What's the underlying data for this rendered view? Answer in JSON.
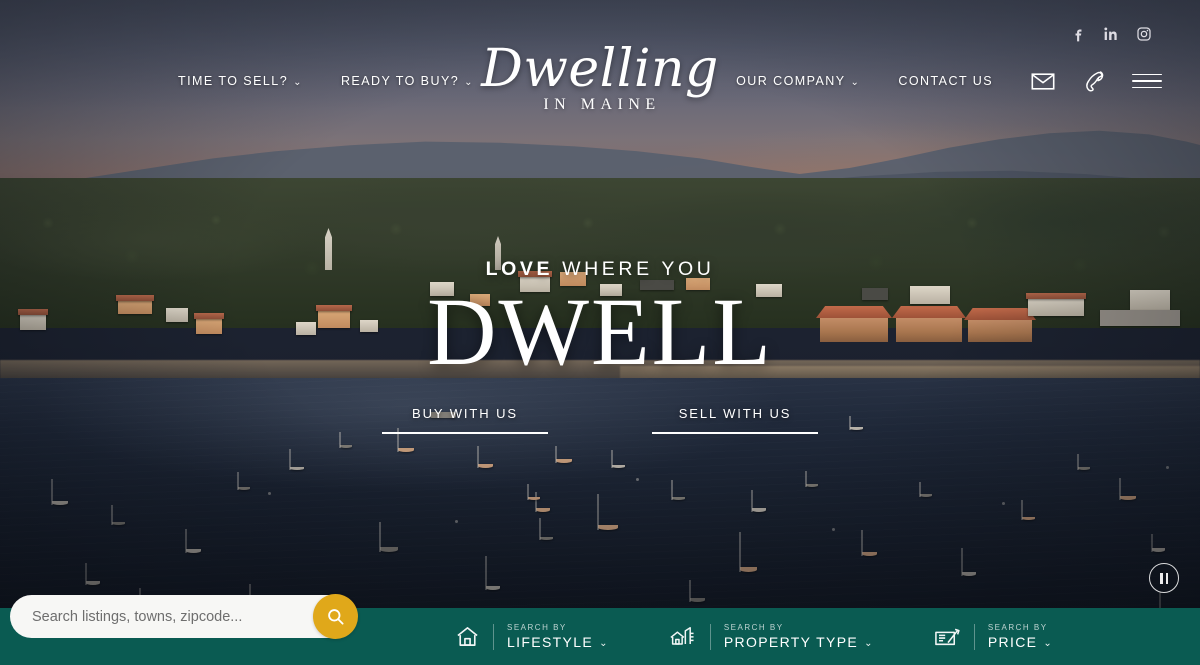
{
  "site": {
    "logo_script": "Dwelling",
    "logo_sub": "IN MAINE"
  },
  "header": {
    "nav_left": [
      {
        "label": "TIME TO SELL?",
        "has_caret": true,
        "caret": "⌄"
      },
      {
        "label": "READY TO BUY?",
        "has_caret": true,
        "caret": "⌄"
      }
    ],
    "nav_right": [
      {
        "label": "OUR COMPANY",
        "has_caret": true,
        "caret": "⌄"
      },
      {
        "label": "CONTACT US",
        "has_caret": false,
        "caret": ""
      }
    ],
    "icons": {
      "mail": "mail-icon",
      "phone": "phone-icon",
      "menu": "hamburger-menu-icon"
    },
    "social": [
      {
        "name": "facebook-icon",
        "label": "Facebook"
      },
      {
        "name": "linkedin-icon",
        "label": "LinkedIn"
      },
      {
        "name": "instagram-icon",
        "label": "Instagram"
      }
    ]
  },
  "hero": {
    "eyebrow_strong": "LOVE",
    "eyebrow_rest": " WHERE YOU",
    "headline": "DWELL",
    "cta": [
      {
        "label": "BUY WITH US"
      },
      {
        "label": "SELL WITH US"
      }
    ],
    "media_control": "pause"
  },
  "search": {
    "placeholder": "Search listings, towns, zipcode...",
    "value": "",
    "submit_icon": "search-icon",
    "filters": [
      {
        "icon": "home-icon",
        "sup": "SEARCH BY",
        "label": "LIFESTYLE",
        "caret": "⌄"
      },
      {
        "icon": "buildings-icon",
        "sup": "SEARCH BY",
        "label": "PROPERTY TYPE",
        "caret": "⌄"
      },
      {
        "icon": "check-money-icon",
        "sup": "SEARCH BY",
        "label": "PRICE",
        "caret": "⌄"
      }
    ]
  },
  "colors": {
    "bar_teal": "#0a5b52",
    "accent_gold": "#e0a81a",
    "text_white": "#ffffff"
  }
}
